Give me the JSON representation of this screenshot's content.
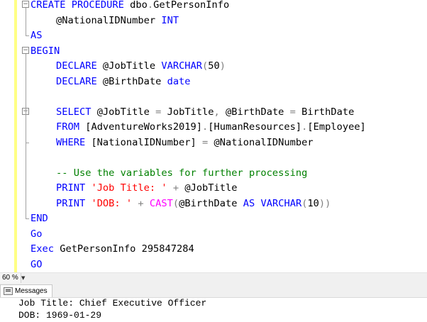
{
  "editor": {
    "lines": [
      {
        "fold": "−",
        "indent": 0,
        "tokens": [
          {
            "t": "kw",
            "v": "CREATE"
          },
          {
            "t": "id",
            "v": " "
          },
          {
            "t": "kw",
            "v": "PROCEDURE"
          },
          {
            "t": "id",
            "v": " dbo"
          },
          {
            "t": "op",
            "v": "."
          },
          {
            "t": "id",
            "v": "GetPersonInfo"
          }
        ]
      },
      {
        "indent": 1,
        "tokens": [
          {
            "t": "id",
            "v": "@NationalIDNumber "
          },
          {
            "t": "kw",
            "v": "INT"
          }
        ]
      },
      {
        "indent": 0,
        "tokens": [
          {
            "t": "kw",
            "v": "AS"
          }
        ]
      },
      {
        "fold": "−",
        "indent": 0,
        "tokens": [
          {
            "t": "kw",
            "v": "BEGIN"
          }
        ]
      },
      {
        "indent": 1,
        "tokens": [
          {
            "t": "kw",
            "v": "DECLARE"
          },
          {
            "t": "id",
            "v": " @JobTitle "
          },
          {
            "t": "kw",
            "v": "VARCHAR"
          },
          {
            "t": "op",
            "v": "("
          },
          {
            "t": "id",
            "v": "50"
          },
          {
            "t": "op",
            "v": ")"
          }
        ]
      },
      {
        "indent": 1,
        "tokens": [
          {
            "t": "kw",
            "v": "DECLARE"
          },
          {
            "t": "id",
            "v": " @BirthDate "
          },
          {
            "t": "kw",
            "v": "date"
          }
        ]
      },
      {
        "indent": 0,
        "tokens": []
      },
      {
        "fold": "−",
        "indent": 1,
        "tokens": [
          {
            "t": "kw",
            "v": "SELECT"
          },
          {
            "t": "id",
            "v": " @JobTitle "
          },
          {
            "t": "op",
            "v": "="
          },
          {
            "t": "id",
            "v": " JobTitle"
          },
          {
            "t": "op",
            "v": ","
          },
          {
            "t": "id",
            "v": " @BirthDate "
          },
          {
            "t": "op",
            "v": "="
          },
          {
            "t": "id",
            "v": " BirthDate"
          }
        ]
      },
      {
        "indent": 1,
        "tokens": [
          {
            "t": "kw",
            "v": "FROM"
          },
          {
            "t": "id",
            "v": " [AdventureWorks2019]"
          },
          {
            "t": "op",
            "v": "."
          },
          {
            "t": "id",
            "v": "[HumanResources]"
          },
          {
            "t": "op",
            "v": "."
          },
          {
            "t": "id",
            "v": "[Employee]"
          }
        ]
      },
      {
        "indent": 1,
        "tokens": [
          {
            "t": "kw",
            "v": "WHERE"
          },
          {
            "t": "id",
            "v": " [NationalIDNumber] "
          },
          {
            "t": "op",
            "v": "="
          },
          {
            "t": "id",
            "v": " @NationalIDNumber"
          }
        ]
      },
      {
        "indent": 0,
        "tokens": []
      },
      {
        "indent": 1,
        "tokens": [
          {
            "t": "cm",
            "v": "-- Use the variables for further processing"
          }
        ]
      },
      {
        "indent": 1,
        "tokens": [
          {
            "t": "kw",
            "v": "PRINT"
          },
          {
            "t": "id",
            "v": " "
          },
          {
            "t": "str",
            "v": "'Job Title: '"
          },
          {
            "t": "id",
            "v": " "
          },
          {
            "t": "op",
            "v": "+"
          },
          {
            "t": "id",
            "v": " @JobTitle"
          }
        ]
      },
      {
        "indent": 1,
        "tokens": [
          {
            "t": "kw",
            "v": "PRINT"
          },
          {
            "t": "id",
            "v": " "
          },
          {
            "t": "str",
            "v": "'DOB: '"
          },
          {
            "t": "id",
            "v": " "
          },
          {
            "t": "op",
            "v": "+"
          },
          {
            "t": "id",
            "v": " "
          },
          {
            "t": "fn",
            "v": "CAST"
          },
          {
            "t": "op",
            "v": "("
          },
          {
            "t": "id",
            "v": "@BirthDate "
          },
          {
            "t": "kw",
            "v": "AS"
          },
          {
            "t": "id",
            "v": " "
          },
          {
            "t": "kw",
            "v": "VARCHAR"
          },
          {
            "t": "op",
            "v": "("
          },
          {
            "t": "id",
            "v": "10"
          },
          {
            "t": "op",
            "v": "))"
          }
        ]
      },
      {
        "indent": 0,
        "tokens": [
          {
            "t": "kw",
            "v": "END"
          }
        ]
      },
      {
        "indent": 0,
        "tokens": [
          {
            "t": "kw",
            "v": "Go"
          }
        ]
      },
      {
        "indent": 0,
        "tokens": [
          {
            "t": "kw",
            "v": "Exec"
          },
          {
            "t": "id",
            "v": " GetPersonInfo 295847284"
          }
        ]
      },
      {
        "indent": 0,
        "tokens": [
          {
            "t": "kw",
            "v": "GO"
          }
        ]
      }
    ]
  },
  "status": {
    "zoom": "60 %",
    "zoom_arrow": "▼"
  },
  "results": {
    "tab_label": "Messages",
    "messages": [
      "Job Title: Chief Executive Officer",
      "DOB: 1969-01-29"
    ]
  },
  "colors": {
    "keyword": "#0000ff",
    "function": "#ff00ff",
    "operator": "#808080",
    "string": "#ff0000",
    "comment": "#008000",
    "margin_bar": "#ffff84"
  }
}
